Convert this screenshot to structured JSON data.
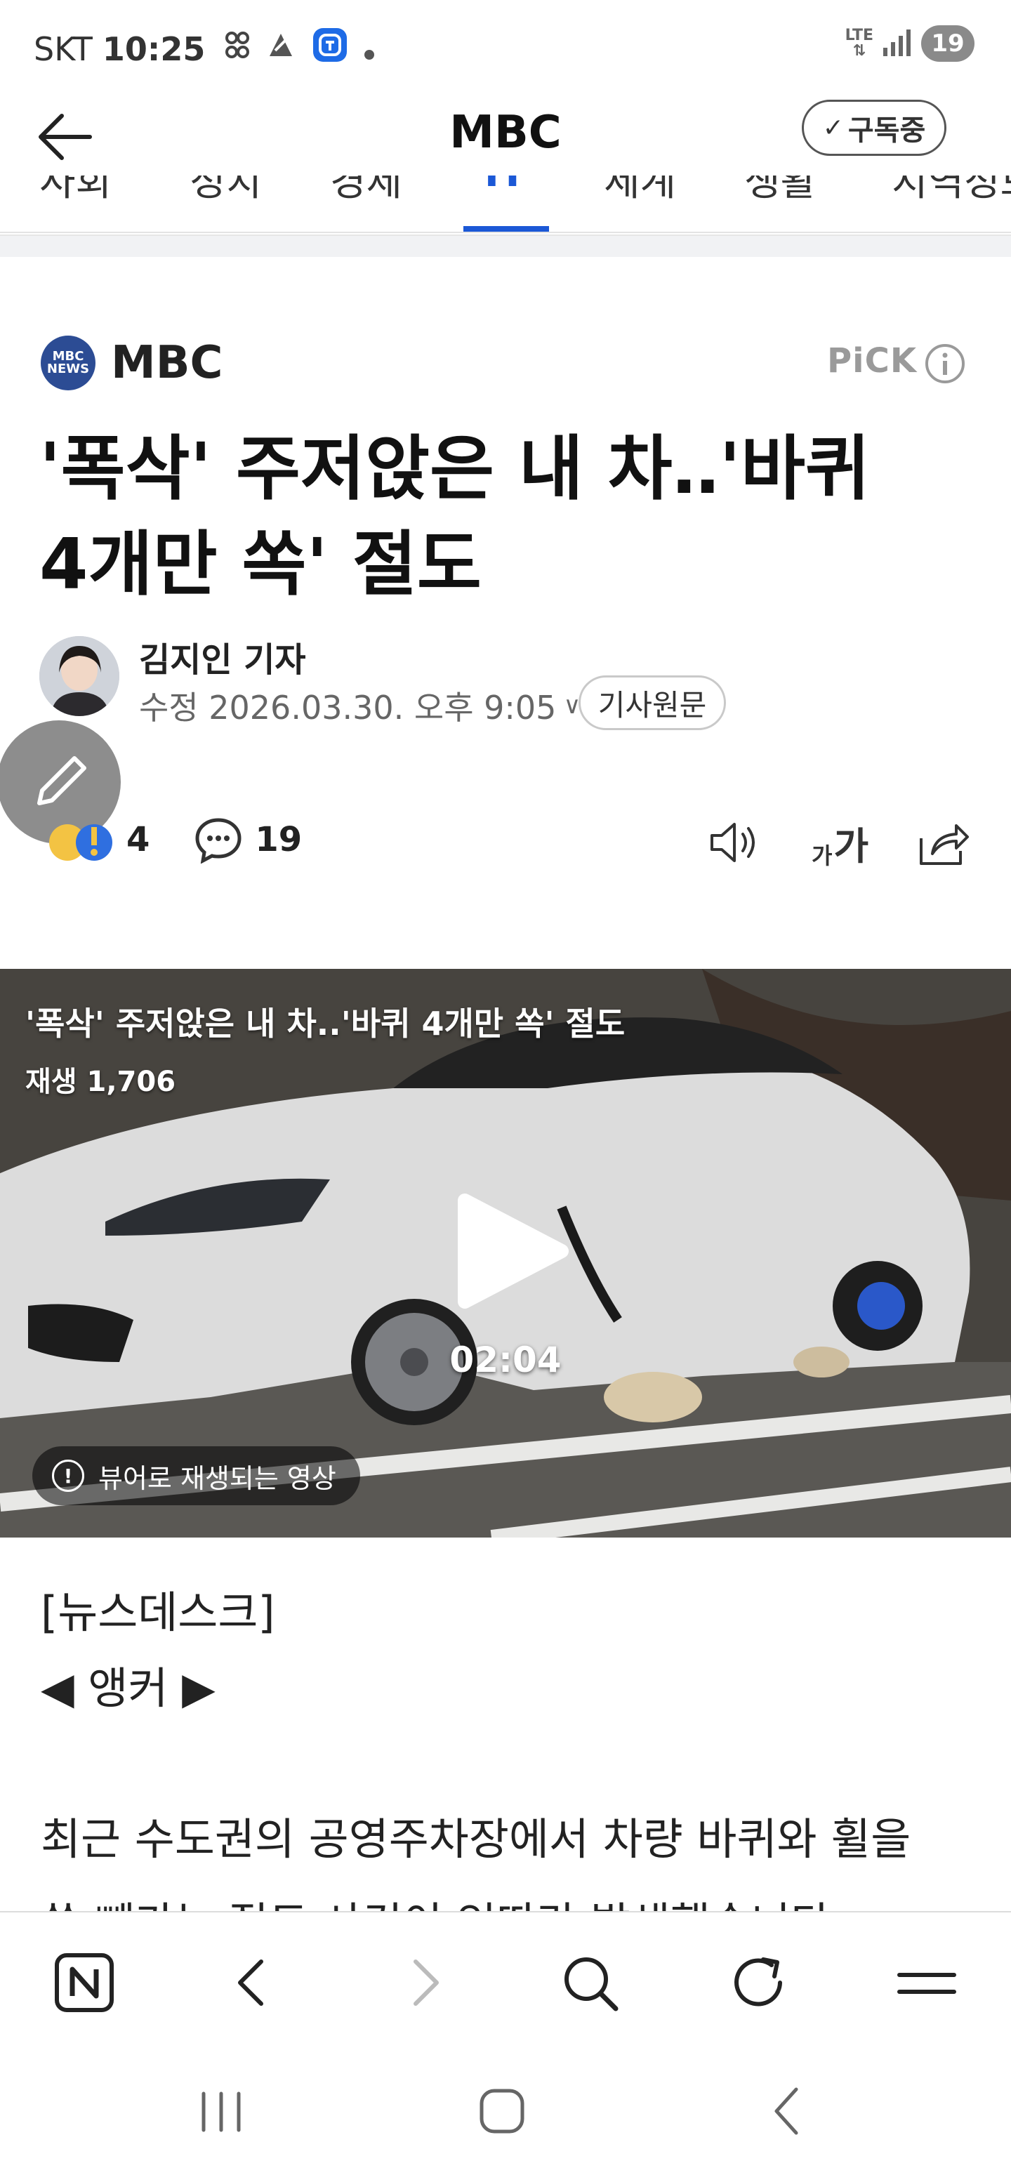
{
  "status_bar": {
    "carrier": "SKT",
    "time": "10:25",
    "network": "LTE",
    "battery": "19",
    "icons": [
      "link-icon",
      "app-icon",
      "t-app-icon",
      "dot-icon",
      "signal-icon"
    ]
  },
  "app_bar": {
    "title": "MBC",
    "subscribe_label": "구독중",
    "back_icon": "arrow-left-icon"
  },
  "tabs": {
    "items": [
      "사회",
      "정치",
      "경제",
      "IT",
      "세계",
      "생활",
      "지역정보"
    ],
    "active_index": 3
  },
  "article": {
    "press_name": "MBC",
    "press_logo_text": "MBC NEWS",
    "pick_label": "PiCK",
    "headline_line1": "'폭삭' 주저앉은 내 차‥'바퀴",
    "headline_line2": "4개만 쏙' 절도",
    "reporter": "김지인 기자",
    "date": "수정 2026.03.30. 오후 9:05",
    "original_link": "기사원문",
    "reaction_count": "4",
    "comment_count": "19",
    "font_label_small": "가",
    "font_label_large": "가"
  },
  "video": {
    "title": "'폭삭' 주저앉은 내 차..'바퀴 4개만 쏙' 절도",
    "views": "재생 1,706",
    "duration": "02:04",
    "notice": "뷰어로 재생되는 영상"
  },
  "body": {
    "section_tag": "[뉴스데스크]",
    "anchor": "◀ 앵커 ▶",
    "paragraph_line1": "최근 수도권의 공영주차장에서 차량 바퀴와 휠을",
    "paragraph_line2": "쏙 빼가는 절도 사건이 잇따라 발생했습니다."
  },
  "bottom_nav": {
    "items": [
      "naver-home-icon",
      "back-icon",
      "forward-icon",
      "search-icon",
      "refresh-icon",
      "menu-icon"
    ]
  },
  "system_nav": {
    "items": [
      "recent-apps-icon",
      "home-icon",
      "system-back-icon"
    ]
  },
  "colors": {
    "accent": "#1b58d6",
    "press_logo": "#2c4c94",
    "muted": "#9a9a9a"
  }
}
